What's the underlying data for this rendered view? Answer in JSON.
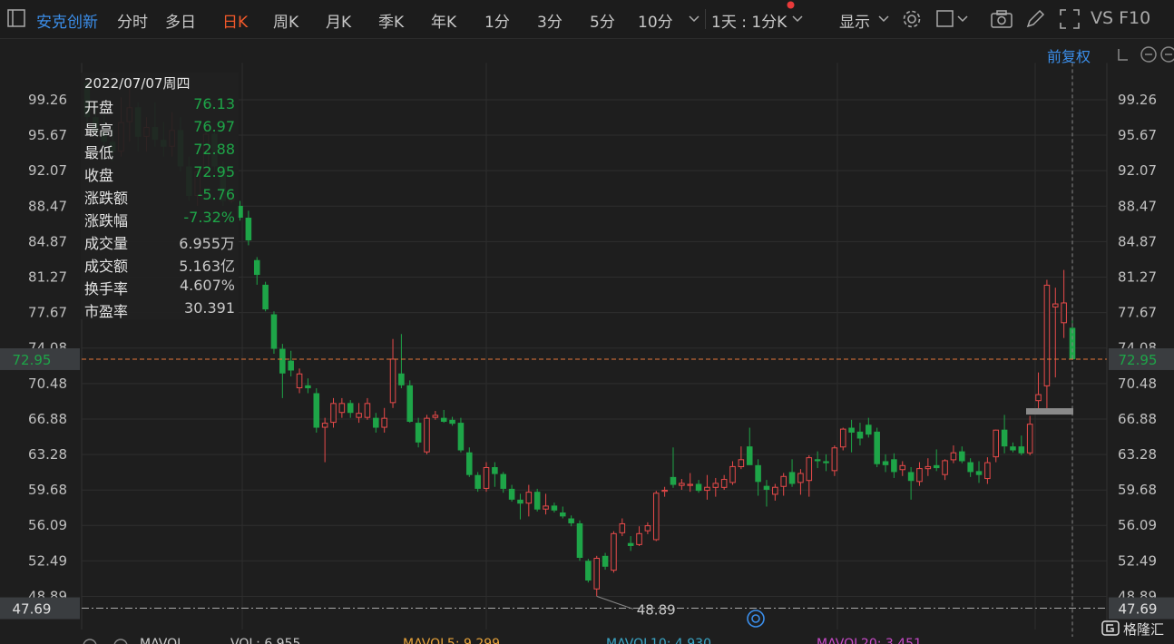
{
  "toolbar": {
    "stock_name": "安克创新",
    "periods": [
      "分时",
      "多日",
      "日K",
      "周K",
      "月K",
      "季K",
      "年K",
      "1分",
      "3分",
      "5分",
      "10分"
    ],
    "active_period": "日K",
    "interval": "1天 : 1分K",
    "display_label": "显示",
    "f10_label": "VS F10"
  },
  "adjust_label": "前复权",
  "info": {
    "date": "2022/07/07周四",
    "rows": [
      {
        "k": "开盘",
        "v": "76.13",
        "color": "green"
      },
      {
        "k": "最高",
        "v": "76.97",
        "color": "green"
      },
      {
        "k": "最低",
        "v": "72.88",
        "color": "green"
      },
      {
        "k": "收盘",
        "v": "72.95",
        "color": "green"
      },
      {
        "k": "涨跌额",
        "v": "-5.76",
        "color": "green"
      },
      {
        "k": "涨跌幅",
        "v": "-7.32%",
        "color": "green"
      },
      {
        "k": "成交量",
        "v": "6.955万",
        "color": "white"
      },
      {
        "k": "成交额",
        "v": "5.163亿",
        "color": "white"
      },
      {
        "k": "换手率",
        "v": "4.607%",
        "color": "white"
      },
      {
        "k": "市盈率",
        "v": "30.391",
        "color": "white"
      }
    ]
  },
  "chart_data": {
    "type": "candlestick",
    "ylim": [
      47.69,
      102.85
    ],
    "y_ticks": [
      "99.26",
      "95.67",
      "92.07",
      "88.47",
      "84.87",
      "81.27",
      "77.67",
      "74.08",
      "70.48",
      "66.88",
      "63.28",
      "59.68",
      "56.09",
      "52.49",
      "48.89"
    ],
    "last_price": 72.95,
    "last_price_label": "72.95",
    "low_price": 47.69,
    "low_price_label": "47.69",
    "min_annotation": "48.89",
    "colors": {
      "up": "#e84a4a",
      "down": "#1ea548",
      "grid": "#2e2e2e",
      "axis_text": "#c0c0c0",
      "price_line": "#e6763a"
    },
    "candles": [
      [
        101,
        101.5,
        96.5,
        97.5
      ],
      [
        97.5,
        99,
        95.5,
        96
      ],
      [
        96,
        98,
        94.5,
        95
      ],
      [
        95,
        96.5,
        93,
        94
      ],
      [
        94,
        99.5,
        93.5,
        97
      ],
      [
        97,
        100.5,
        95,
        98.5
      ],
      [
        98.5,
        99,
        94,
        95.5
      ],
      [
        95.5,
        97.5,
        94,
        96.5
      ],
      [
        96.5,
        99,
        94.5,
        95.2
      ],
      [
        95.2,
        97,
        93.5,
        94.5
      ],
      [
        94.5,
        98,
        93.5,
        96.2
      ],
      [
        96.2,
        97.5,
        92,
        92.5
      ],
      [
        92.5,
        93.5,
        89,
        89.5
      ],
      [
        89.5,
        92.5,
        88.5,
        92
      ],
      [
        92,
        96,
        91.5,
        95.8
      ],
      [
        95.8,
        96,
        92,
        92.5
      ],
      [
        92.5,
        93,
        88.5,
        89
      ],
      [
        89,
        89.6,
        88.8,
        89.3
      ],
      [
        88.5,
        89,
        87,
        87.3
      ],
      [
        87.3,
        88,
        84.5,
        85
      ],
      [
        83,
        83.3,
        80.5,
        81.5
      ],
      [
        80.5,
        80.8,
        77.8,
        78
      ],
      [
        77.5,
        77.8,
        73.5,
        74
      ],
      [
        74,
        74.5,
        69,
        71.5
      ],
      [
        72.8,
        73.8,
        71.2,
        71.8
      ],
      [
        70,
        72,
        69.5,
        71.5
      ],
      [
        70.3,
        71,
        69.5,
        70
      ],
      [
        69.5,
        70,
        65.5,
        66
      ],
      [
        66,
        67,
        62.5,
        66.5
      ],
      [
        66.5,
        69,
        66,
        68.5
      ],
      [
        67.5,
        69,
        67,
        68.5
      ],
      [
        68.5,
        68.8,
        67,
        67.5
      ],
      [
        67,
        68.5,
        66.5,
        67.5
      ],
      [
        67,
        69,
        66.8,
        68.5
      ],
      [
        67,
        67.5,
        65.5,
        66
      ],
      [
        66,
        68,
        65.5,
        67
      ],
      [
        68.5,
        75,
        68,
        73
      ],
      [
        71.5,
        75.5,
        70,
        70.3
      ],
      [
        70.3,
        70.8,
        66.5,
        66.6
      ],
      [
        66.5,
        67,
        64,
        64.5
      ],
      [
        63.5,
        67.3,
        63.3,
        67
      ],
      [
        67,
        67.7,
        66.8,
        67.3
      ],
      [
        67,
        67.8,
        66.5,
        66.6
      ],
      [
        66.8,
        67.1,
        66.2,
        66.4
      ],
      [
        66.5,
        67,
        63.5,
        63.7
      ],
      [
        63.5,
        64,
        61,
        61.2
      ],
      [
        61.2,
        61.5,
        59.5,
        59.8
      ],
      [
        59.8,
        62.5,
        59.5,
        62
      ],
      [
        62,
        62.5,
        60,
        61.3
      ],
      [
        61.3,
        61.5,
        59.4,
        59.8
      ],
      [
        59.8,
        60.2,
        58.5,
        58.7
      ],
      [
        58.7,
        59.3,
        56.7,
        58.3
      ],
      [
        58.3,
        60.2,
        57,
        59.5
      ],
      [
        59.5,
        59.8,
        57.5,
        57.7
      ],
      [
        57.7,
        59.3,
        57.2,
        58.1
      ],
      [
        58.1,
        58.4,
        57.4,
        57.6
      ],
      [
        57.4,
        58,
        56.8,
        57
      ],
      [
        56.8,
        57.1,
        56,
        56.3
      ],
      [
        56.3,
        56.6,
        52.5,
        52.8
      ],
      [
        52.5,
        52.7,
        50.3,
        50.5
      ],
      [
        49.6,
        53,
        48.9,
        52.8
      ],
      [
        53,
        53.3,
        51.6,
        51.9
      ],
      [
        51.5,
        55.5,
        51.3,
        55.3
      ],
      [
        55.3,
        56.8,
        55,
        56.3
      ],
      [
        54.3,
        55,
        53.5,
        54
      ],
      [
        54.1,
        56,
        54,
        55.3
      ],
      [
        55.5,
        56.4,
        55.2,
        56.1
      ],
      [
        54.6,
        59.6,
        54.5,
        59.4
      ],
      [
        59.5,
        60,
        59,
        59.7
      ],
      [
        61,
        64,
        59.9,
        60.2
      ],
      [
        60.1,
        60.8,
        59.7,
        60.4
      ],
      [
        60.1,
        61.4,
        59.5,
        60.3
      ],
      [
        60.3,
        60.7,
        59.4,
        59.6
      ],
      [
        59.6,
        61.2,
        58.7,
        60
      ],
      [
        59.9,
        60.9,
        59,
        60.4
      ],
      [
        59.9,
        61.2,
        59.7,
        60.8
      ],
      [
        60.4,
        62.6,
        60.2,
        62.1
      ],
      [
        62,
        64.1,
        61.8,
        62.8
      ],
      [
        64.1,
        66,
        63.4,
        62.2
      ],
      [
        62.2,
        62.8,
        59.1,
        60.5
      ],
      [
        60.1,
        60.7,
        58,
        59.7
      ],
      [
        59.2,
        60.3,
        58.6,
        60
      ],
      [
        60,
        61.4,
        59.1,
        61.1
      ],
      [
        61.5,
        62.8,
        60,
        60.3
      ],
      [
        60.4,
        61.8,
        59.2,
        61.4
      ],
      [
        60.6,
        63.2,
        59,
        63
      ],
      [
        62.8,
        63.6,
        61.9,
        62.6
      ],
      [
        62.6,
        63.3,
        61.6,
        62.4
      ],
      [
        61.6,
        64.2,
        61.1,
        64
      ],
      [
        64,
        66,
        63.7,
        65.9
      ],
      [
        66,
        66.8,
        63.5,
        65.5
      ],
      [
        65.6,
        66.5,
        64.2,
        64.9
      ],
      [
        66.3,
        67,
        65,
        65.3
      ],
      [
        65.6,
        66,
        62,
        62.3
      ],
      [
        62.6,
        63.3,
        61.5,
        62.2
      ],
      [
        62.8,
        63.4,
        60.9,
        61.5
      ],
      [
        61.7,
        62.6,
        61.1,
        62.2
      ],
      [
        61.5,
        62,
        58.7,
        60.6
      ],
      [
        60.5,
        62.5,
        60.1,
        61.9
      ],
      [
        61.8,
        62.9,
        61.1,
        62.1
      ],
      [
        62.2,
        63.8,
        61.6,
        61.9
      ],
      [
        61.2,
        62.8,
        60.7,
        62.7
      ],
      [
        62.7,
        64.2,
        62.4,
        63.5
      ],
      [
        63.6,
        64.1,
        62.4,
        62.6
      ],
      [
        62.5,
        62.9,
        61,
        61.5
      ],
      [
        61.6,
        62.6,
        60.4,
        61.2
      ],
      [
        60.8,
        63,
        60.3,
        62.5
      ],
      [
        63,
        65.8,
        62.5,
        65.8
      ],
      [
        65.8,
        67.3,
        63.4,
        64.1
      ],
      [
        64.1,
        64.5,
        63.5,
        63.7
      ],
      [
        64.1,
        65.2,
        63.2,
        63.4
      ],
      [
        63.4,
        67.2,
        63.2,
        66.4
      ],
      [
        68.7,
        71.6,
        67.9,
        69.4
      ],
      [
        70.2,
        81,
        67.8,
        80.5
      ],
      [
        78.2,
        80.2,
        71.1,
        78.6
      ],
      [
        76.6,
        82,
        75.1,
        78.7
      ],
      [
        76.13,
        76.97,
        72.88,
        72.95
      ]
    ],
    "signal_x": [
      268,
      340,
      412,
      576,
      588,
      638,
      650,
      679,
      690,
      741,
      761,
      782,
      793,
      812,
      824,
      915,
      936,
      947,
      957,
      977,
      1059,
      1069,
      1142,
      1174
    ]
  },
  "volume_bar": {
    "title": "MAVOL",
    "items": [
      {
        "label": "VOL",
        "value": "6.955",
        "color": "#c8c8c8"
      },
      {
        "label": "MAVOL5",
        "value": "9.299",
        "color": "#e8a33a"
      },
      {
        "label": "MAVOL10",
        "value": "4.930",
        "color": "#3aa7c8"
      },
      {
        "label": "MAVOL20",
        "value": "3.451",
        "color": "#c84ac8"
      }
    ]
  },
  "logo": "格隆汇"
}
